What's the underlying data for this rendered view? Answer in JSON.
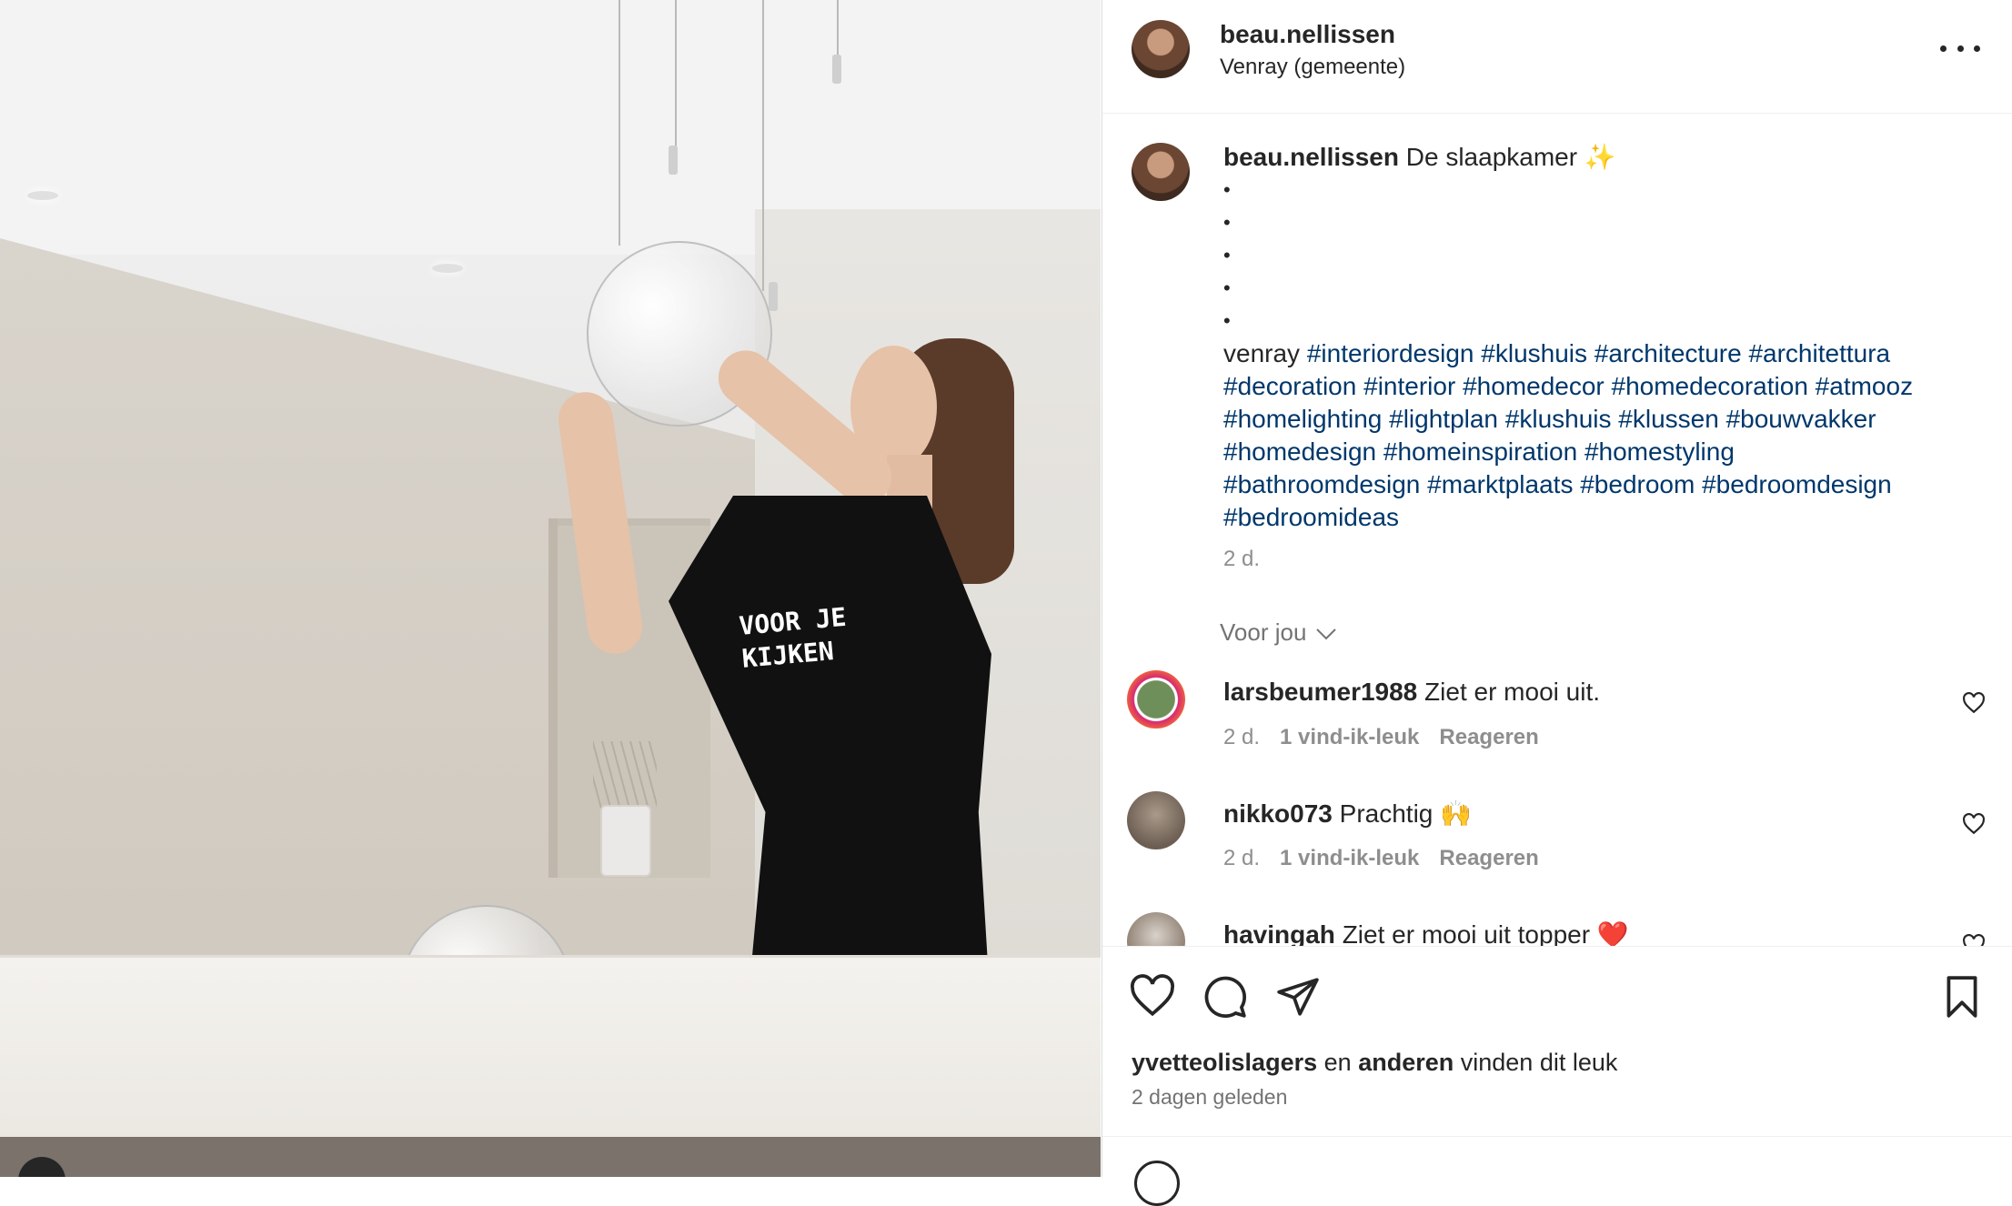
{
  "post": {
    "username": "beau.nellissen",
    "location": "Venray (gemeente)"
  },
  "caption": {
    "username": "beau.nellissen",
    "title": "De slaapkamer ✨",
    "bullets": [
      "•",
      "•",
      "•",
      "•",
      "•"
    ],
    "lead_word": "venray",
    "hashtags": [
      "#interiordesign",
      "#klushuis",
      "#architecture",
      "#architettura",
      "#decoration",
      "#interior",
      "#homedecor",
      "#homedecoration",
      "#atmooz",
      "#homelighting",
      "#lightplan",
      "#klushuis",
      "#klussen",
      "#bouwvakker",
      "#homedesign",
      "#homeinspiration",
      "#homestyling",
      "#bathroomdesign",
      "#marktplaats",
      "#bedroom",
      "#bedroomdesign",
      "#bedroomideas"
    ],
    "time": "2 d."
  },
  "voor_jou": "Voor jou",
  "comments": [
    {
      "user": "larsbeumer1988",
      "text": "Ziet er mooi uit.",
      "time": "2 d.",
      "likes": "1 vind-ik-leuk",
      "reply": "Reageren"
    },
    {
      "user": "nikko073",
      "text": "Prachtig 🙌",
      "time": "2 d.",
      "likes": "1 vind-ik-leuk",
      "reply": "Reageren"
    },
    {
      "user": "havingah",
      "text": "Ziet er mooi uit topper ❤️"
    }
  ],
  "likes_line": {
    "user": "yvetteolislagers",
    "connector": "en",
    "others": "anderen",
    "suffix": "vinden dit leuk"
  },
  "time_ago": "2 dagen geleden",
  "media_print": [
    "VOOR JE",
    "KIJKEN"
  ],
  "icons": [
    "more-icon",
    "heart-icon",
    "comment-icon",
    "share-icon",
    "bookmark-icon",
    "chevron-down-icon",
    "emoji-icon"
  ]
}
